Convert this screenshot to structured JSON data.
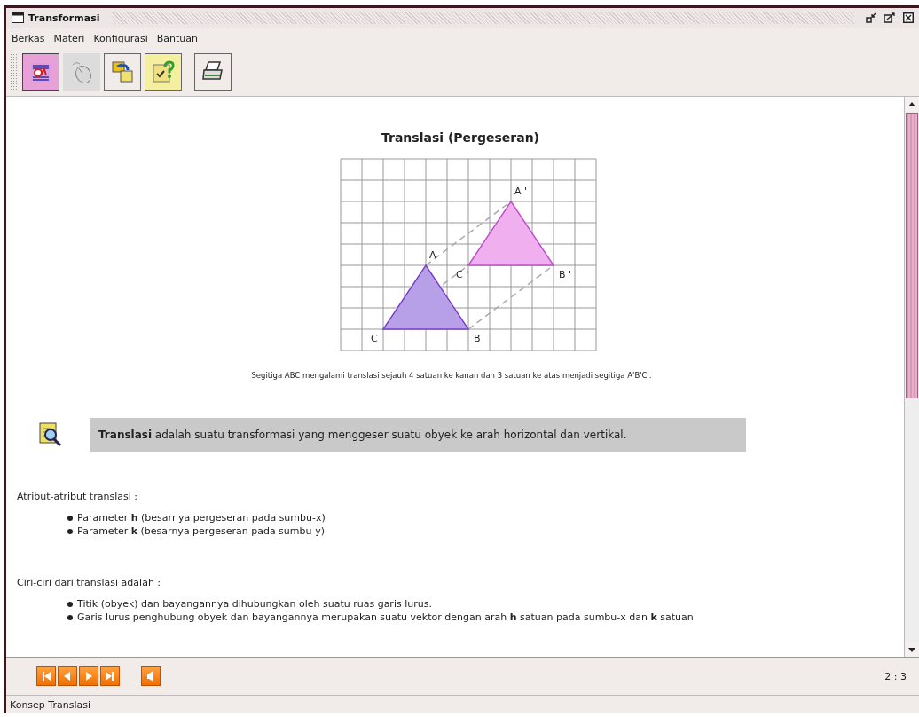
{
  "window": {
    "title": "Transformasi"
  },
  "menu": [
    {
      "label": "Berkas"
    },
    {
      "label": "Materi"
    },
    {
      "label": "Konfigurasi"
    },
    {
      "label": "Bantuan"
    }
  ],
  "toolbar": [
    {
      "kind": "material",
      "selected": true
    },
    {
      "kind": "mouse",
      "selected": false
    },
    {
      "kind": "swap",
      "selected": false
    },
    {
      "kind": "quiz",
      "selected": false
    },
    {
      "kind": "print",
      "selected": false
    }
  ],
  "content": {
    "heading": "Translasi (Pergeseran)",
    "figure_labels": [
      "A",
      "B",
      "C",
      "A '",
      "B '",
      "C '"
    ],
    "caption": "Segitiga ABC mengalami translasi sejauh 4 satuan ke kanan dan 3 satuan ke atas menjadi segitiga A'B'C'.",
    "definition": "**Translasi** adalah suatu transformasi yang menggeser suatu obyek ke arah horizontal dan vertikal.",
    "sections": [
      {
        "title": "Atribut-atribut translasi :",
        "items": [
          "Parameter **h** (besarnya pergeseran pada sumbu-x)",
          "Parameter **k** (besarnya pergeseran pada sumbu-y)"
        ]
      },
      {
        "title": "Ciri-ciri dari translasi adalah :",
        "items": [
          "Titik (obyek) dan bayangannya dihubungkan oleh suatu ruas garis lurus.",
          "Garis lurus penghubung obyek dan bayangannya merupakan suatu vektor dengan arah **h** satuan pada sumbu-x dan **k** satuan"
        ]
      }
    ]
  },
  "navigation": {
    "buttons": [
      {
        "kind": "first"
      },
      {
        "kind": "previous"
      },
      {
        "kind": "next"
      },
      {
        "kind": "last"
      },
      {
        "kind": "back"
      }
    ],
    "page": "2 : 3"
  },
  "status_bar": "Konsep Translasi"
}
